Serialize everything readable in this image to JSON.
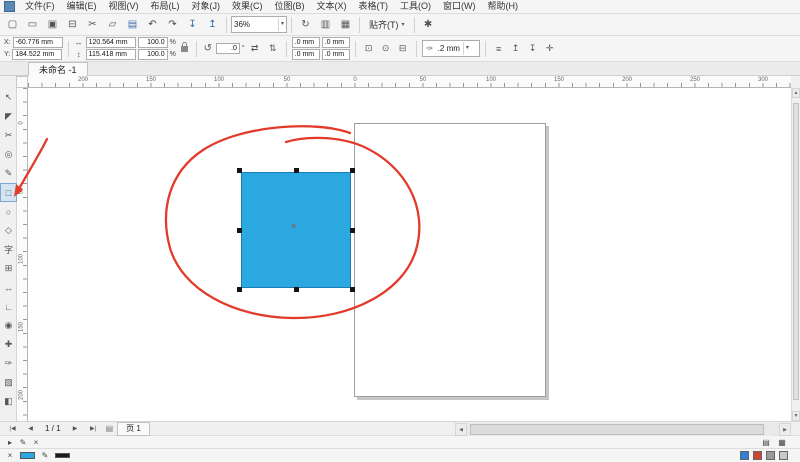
{
  "colors": {
    "annotation_red": "#e23a2b",
    "square_fill": "#2ba8e0",
    "square_border": "#187cb4",
    "fill_swatch": "#2ba8e0",
    "outline_swatch": "#1a1a1a"
  },
  "icons": {
    "dropdown": "▾",
    "up": "▲",
    "down": "▼",
    "left": "◀",
    "right": "▶"
  },
  "menu": {
    "items": [
      {
        "name": "menu-file",
        "label": "文件(F)"
      },
      {
        "name": "menu-edit",
        "label": "编辑(E)"
      },
      {
        "name": "menu-view",
        "label": "视图(V)"
      },
      {
        "name": "menu-layout",
        "label": "布局(L)"
      },
      {
        "name": "menu-object",
        "label": "对象(J)"
      },
      {
        "name": "menu-effects",
        "label": "效果(C)"
      },
      {
        "name": "menu-bitmaps",
        "label": "位图(B)"
      },
      {
        "name": "menu-text",
        "label": "文本(X)"
      },
      {
        "name": "menu-table",
        "label": "表格(T)"
      },
      {
        "name": "menu-tools",
        "label": "工具(O)"
      },
      {
        "name": "menu-window",
        "label": "窗口(W)"
      },
      {
        "name": "menu-help",
        "label": "帮助(H)"
      }
    ]
  },
  "toolbar": {
    "buttons": [
      {
        "name": "new-document-button",
        "glyph": "▢"
      },
      {
        "name": "open-button",
        "glyph": "▭"
      },
      {
        "name": "save-button",
        "glyph": "▣"
      },
      {
        "name": "print-button",
        "glyph": "⊟"
      },
      {
        "name": "cut-button",
        "glyph": "✂"
      },
      {
        "name": "copy-button",
        "glyph": "▱"
      },
      {
        "name": "paste-button",
        "glyph": "▤",
        "color": "#3f6fae"
      },
      {
        "name": "undo-button",
        "glyph": "↶",
        "color": "#444444"
      },
      {
        "name": "redo-button",
        "glyph": "↷",
        "color": "#444444"
      },
      {
        "name": "import-button",
        "glyph": "↧",
        "color": "#2e6fb0"
      },
      {
        "name": "export-button",
        "glyph": "↥",
        "color": "#2e6fb0"
      }
    ],
    "zoom_value": "36%",
    "view_buttons": [
      {
        "name": "refresh-button",
        "glyph": "↻"
      },
      {
        "name": "show-rulers-button",
        "glyph": "▥"
      },
      {
        "name": "show-grid-button",
        "glyph": "▦"
      }
    ],
    "snap_label": "贴齐(T)",
    "options_glyph": "✱"
  },
  "propbar": {
    "position": {
      "x_label": "X:",
      "x_value": "-60.776 mm",
      "y_label": "Y:",
      "y_value": "184.522 mm"
    },
    "size": {
      "width_icon": "↔",
      "width_value": "120.564 mm",
      "height_icon": "↕",
      "height_value": "115.418 mm"
    },
    "scale": {
      "x_value": "100.0",
      "y_value": "100.0",
      "unit": "%"
    },
    "rotation": {
      "icon": "↺",
      "value": ".0",
      "unit": "°"
    },
    "mirror": {
      "h_glyph": "⇄",
      "v_glyph": "⇅"
    },
    "corners": {
      "tl": ".0 mm",
      "tr": ".0 mm",
      "bl": ".0 mm",
      "br": ".0 mm"
    },
    "buttons": [
      {
        "name": "round-corner-button",
        "glyph": "⊡"
      },
      {
        "name": "scalloped-corner-button",
        "glyph": "⊙"
      },
      {
        "name": "chamfered-corner-button",
        "glyph": "⊟"
      }
    ],
    "outline": {
      "icon": "✑",
      "value": ".2 mm"
    },
    "right_buttons": [
      {
        "name": "wrap-text-button",
        "glyph": "≡"
      },
      {
        "name": "to-front-button",
        "glyph": "↥"
      },
      {
        "name": "to-back-button",
        "glyph": "↧"
      },
      {
        "name": "convert-to-curves-button",
        "glyph": "✛"
      }
    ]
  },
  "document": {
    "tab_title": "未命名 -1"
  },
  "hruler": {
    "labels": [
      "200",
      "150",
      "100",
      "50",
      "0",
      "50",
      "100",
      "150",
      "200",
      "250",
      "300"
    ]
  },
  "vruler": {
    "labels": [
      "0",
      "50",
      "100",
      "150",
      "200"
    ]
  },
  "toolbox": {
    "tools": [
      {
        "name": "tool-pick",
        "glyph": "↖"
      },
      {
        "name": "tool-shape",
        "glyph": "◤"
      },
      {
        "name": "tool-crop",
        "glyph": "✂"
      },
      {
        "name": "tool-zoom",
        "glyph": "◎"
      },
      {
        "name": "tool-freehand",
        "glyph": "✎"
      },
      {
        "name": "tool-rectangle",
        "glyph": "□",
        "active": true
      },
      {
        "name": "tool-ellipse",
        "glyph": "○"
      },
      {
        "name": "tool-polygon",
        "glyph": "◇"
      },
      {
        "name": "tool-text",
        "glyph": "字"
      },
      {
        "name": "tool-table",
        "glyph": "⊞"
      },
      {
        "name": "tool-dimension",
        "glyph": "↔"
      },
      {
        "name": "tool-connector",
        "glyph": "∟"
      },
      {
        "name": "tool-blend",
        "glyph": "◉"
      },
      {
        "name": "tool-eyedropper",
        "glyph": "✚"
      },
      {
        "name": "tool-outline-pen",
        "glyph": "✑"
      },
      {
        "name": "tool-fill",
        "glyph": "▨"
      },
      {
        "name": "tool-interactive-fill",
        "glyph": "◧"
      }
    ]
  },
  "canvas": {
    "center_mark_glyph": "×"
  },
  "pagebar": {
    "nav_prev": [
      {
        "name": "first-page-button",
        "glyph": "|◀"
      },
      {
        "name": "prev-page-button",
        "glyph": "◀"
      }
    ],
    "indicator": "1 / 1",
    "nav_next": [
      {
        "name": "next-page-button",
        "glyph": "▶"
      },
      {
        "name": "last-page-button",
        "glyph": "▶|"
      }
    ],
    "page_icon_glyph": "▤",
    "page_tab": "页 1"
  },
  "statusbar": {
    "left_icons": [
      {
        "name": "status-play-icon",
        "glyph": "▸"
      },
      {
        "name": "status-pen-icon",
        "glyph": "✎"
      },
      {
        "name": "status-close-icon",
        "glyph": "×"
      }
    ],
    "right_icons": [
      {
        "name": "status-panel-icon",
        "glyph": "▤"
      },
      {
        "name": "status-grid-icon",
        "glyph": "▦"
      }
    ],
    "no_fill_glyph": "×",
    "pen_glyph": "✎",
    "chips": [
      {
        "name": "chip-blue",
        "bg": "#2f7fd6"
      },
      {
        "name": "chip-red",
        "bg": "#cf4433"
      },
      {
        "name": "chip-grey",
        "bg": "#9a9a9a"
      },
      {
        "name": "chip-light",
        "bg": "#c9c9c9"
      }
    ]
  }
}
